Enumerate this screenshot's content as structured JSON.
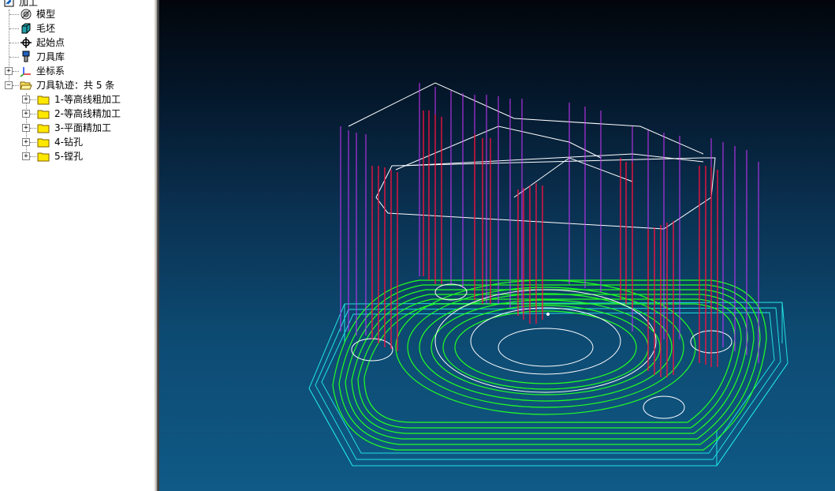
{
  "tree": {
    "root_label": "加工",
    "items": [
      {
        "label": "模型",
        "icon": "model-icon"
      },
      {
        "label": "毛坯",
        "icon": "stock-icon"
      },
      {
        "label": "起始点",
        "icon": "start-point-icon"
      },
      {
        "label": "刀具库",
        "icon": "tool-library-icon"
      },
      {
        "label": "坐标系",
        "icon": "coordinate-system-icon"
      },
      {
        "label": "刀具轨迹：共 5 条",
        "icon": "open-folder-icon"
      }
    ],
    "toolpaths": [
      {
        "label": "1-等高线粗加工"
      },
      {
        "label": "2-等高线精加工"
      },
      {
        "label": "3-平面精加工"
      },
      {
        "label": "4-钻孔"
      },
      {
        "label": "5-镗孔"
      }
    ],
    "expand_symbols": {
      "plus": "+",
      "minus": "−"
    }
  },
  "viewport": {
    "colors": {
      "bg_top": "#02060b",
      "bg_bottom": "#0f5a86",
      "finish": "#22ff22",
      "rough": "#ff1040",
      "retract": "#cc33ff",
      "stock": "#20e0e0",
      "model": "#ffffff"
    }
  }
}
